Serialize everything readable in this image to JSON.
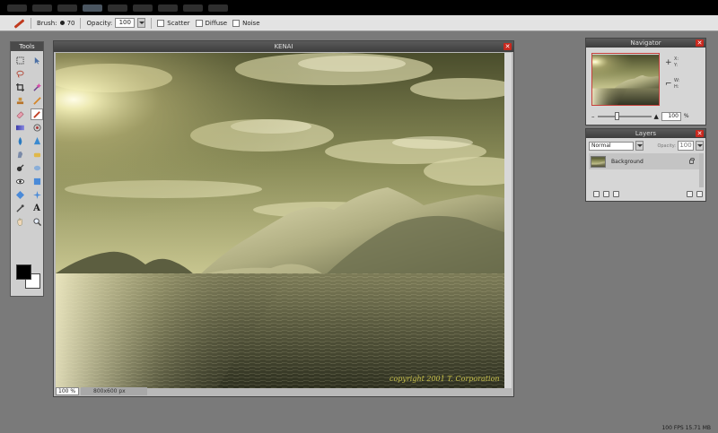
{
  "menu": {
    "count_note": "",
    "items": [
      {
        "label": ""
      },
      {
        "label": ""
      },
      {
        "label": ""
      },
      {
        "label": ""
      },
      {
        "label": ""
      },
      {
        "label": ""
      },
      {
        "label": ""
      },
      {
        "label": ""
      },
      {
        "label": ""
      },
      {
        "label": ""
      }
    ]
  },
  "options": {
    "brush_label": "Brush:",
    "brush_size": "70",
    "opacity_label": "Opacity:",
    "opacity_value": "100",
    "scatter_label": "Scatter",
    "diffuse_label": "Diffuse",
    "noise_label": "Noise"
  },
  "tools_panel": {
    "title": "Tools",
    "type_tool_glyph": "A"
  },
  "image_window": {
    "title": "KENAI",
    "zoom": "100 %",
    "dimensions": "800x600 px",
    "watermark": "copyright 2001 T. Corporation"
  },
  "navigator": {
    "title": "Navigator",
    "x_label": "X:",
    "y_label": "Y:",
    "w_label": "W:",
    "h_label": "H:",
    "zoom_value": "100",
    "zoom_unit": "%",
    "zoom_level": 0.35
  },
  "layers": {
    "title": "Layers",
    "blend_mode": "Normal",
    "opacity_label": "Opacity:",
    "opacity_value": "100",
    "layer_name": "Background"
  },
  "status": {
    "fps": "100 FPS 15.71 MB"
  },
  "colors": {
    "foreground": "#000000",
    "background": "#ffffff",
    "close": "#c8281e"
  }
}
